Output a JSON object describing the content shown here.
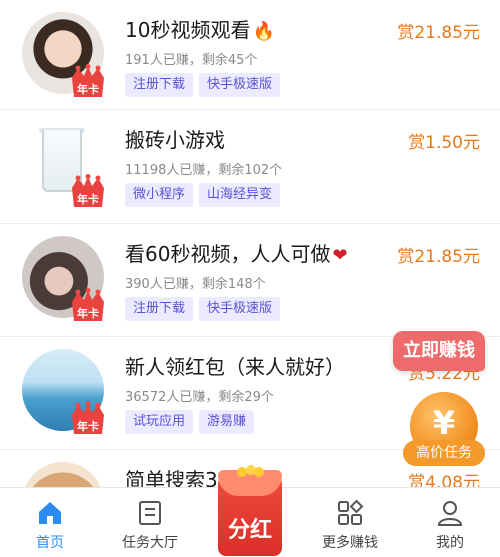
{
  "tasks": [
    {
      "title": "10秒视频观看",
      "emoji": "🔥",
      "stats": "191人已赚，剩余45个",
      "tags": [
        "注册下载",
        "快手极速版"
      ],
      "reward": "赏21.85元",
      "badge": "年卡",
      "avatar": "young-man-photo"
    },
    {
      "title": "搬砖小游戏",
      "emoji": "",
      "stats": "11198人已赚，剩余102个",
      "tags": [
        "微小程序",
        "山海经异变"
      ],
      "reward": "赏1.50元",
      "badge": "年卡",
      "avatar": "glass-cup-photo"
    },
    {
      "title": "看60秒视频，人人可做",
      "emoji": "❤",
      "stats": "390人已赚，剩余148个",
      "tags": [
        "注册下载",
        "快手极速版"
      ],
      "reward": "赏21.85元",
      "badge": "年卡",
      "avatar": "girl-photo"
    },
    {
      "title": "新人领红包（来人就好）",
      "emoji": "",
      "stats": "36572人已赚，剩余29个",
      "tags": [
        "试玩应用",
        "游易赚"
      ],
      "reward": "赏5.22元",
      "badge": "年卡",
      "avatar": "sea-photo"
    },
    {
      "title": "简单搜索3",
      "emoji": "",
      "stats": "",
      "tags": [],
      "reward": "赏4.08元",
      "badge": "",
      "avatar": "baby-photo"
    }
  ],
  "floating": {
    "earn_now": "立即赚钱",
    "coin_symbol": "¥",
    "high_price": "高价任务"
  },
  "nav": {
    "items": [
      {
        "label": "首页",
        "icon": "home-icon",
        "active": true
      },
      {
        "label": "任务大厅",
        "icon": "task-list-icon",
        "active": false
      },
      {
        "label": "分红",
        "icon": "red-envelope-icon",
        "active": false
      },
      {
        "label": "更多赚钱",
        "icon": "grid-apps-icon",
        "active": false
      },
      {
        "label": "我的",
        "icon": "person-icon",
        "active": false
      }
    ]
  },
  "colors": {
    "accent_blue": "#2a8cf0",
    "reward_orange": "#e57a1c",
    "tag_purple": "#5b52d6",
    "tag_bg": "#eceaff",
    "earn_red": "#ef6b6b"
  }
}
